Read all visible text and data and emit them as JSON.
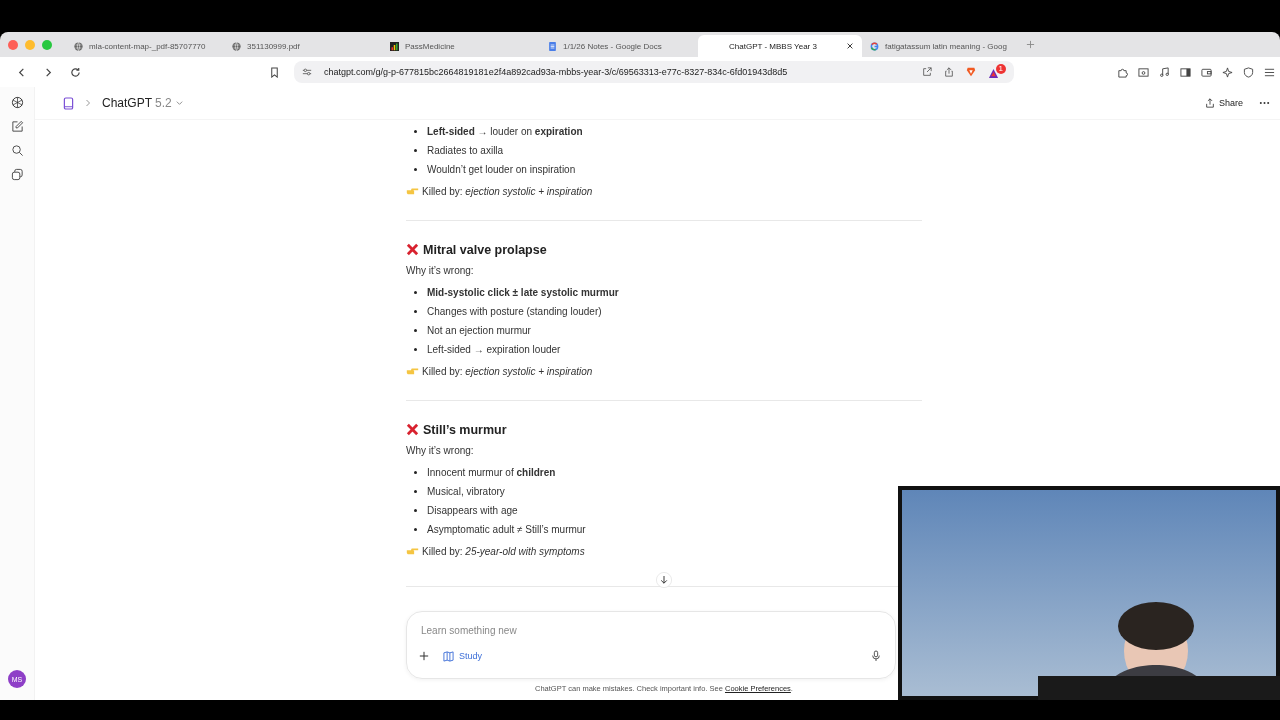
{
  "browser": {
    "tabs": [
      {
        "title": "mla-content-map-_pdf-85707770",
        "kind": "globe",
        "selected": false
      },
      {
        "title": "351130999.pdf",
        "kind": "globe",
        "selected": false
      },
      {
        "title": "PassMedicine",
        "kind": "bars",
        "selected": false
      },
      {
        "title": "1/1/26 Notes - Google Docs",
        "kind": "doc",
        "selected": false
      },
      {
        "title": "ChatGPT - MBBS Year 3",
        "kind": "plain",
        "selected": true
      },
      {
        "title": "fatigatassum latin meaning - Goog",
        "kind": "google",
        "selected": false
      }
    ],
    "address": "chatgpt.com/g/g-p-677815bc2664819181e2f4a892cad93a-mbbs-year-3/c/69563313-e77c-8327-834c-6fd01943d8d5",
    "notification_count": "1"
  },
  "header": {
    "model": "ChatGPT",
    "version": "5.2",
    "share": "Share"
  },
  "intro": {
    "bullets": [
      "**Left-sided** → louder on **expiration**",
      "Radiates to axilla",
      "Wouldn’t get louder on inspiration"
    ],
    "killed_by": "Killed by: *ejection systolic + inspiration*"
  },
  "sections": [
    {
      "title": "Mitral valve prolapse",
      "subtitle": "Why it’s wrong:",
      "bullets": [
        "**Mid-systolic click ± late systolic murmur**",
        "Changes with posture (standing louder)",
        "Not an ejection murmur",
        "Left-sided → expiration louder"
      ],
      "killed_by": "Killed by: *ejection systolic + inspiration*"
    },
    {
      "title": "Still’s murmur",
      "subtitle": "Why it’s wrong:",
      "bullets": [
        "Innocent murmur of **children**",
        "Musical, vibratory",
        "Disappears with age",
        "Asymptomatic adult ≠ Still’s murmur"
      ],
      "killed_by": "Killed by: *25-year-old with symptoms*"
    }
  ],
  "composer": {
    "placeholder": "Learn something new",
    "study": "Study"
  },
  "footer": {
    "text": "ChatGPT can make mistakes. Check important info. See",
    "link": "Cookie Preferences",
    "end": "."
  },
  "avatar": "MS"
}
